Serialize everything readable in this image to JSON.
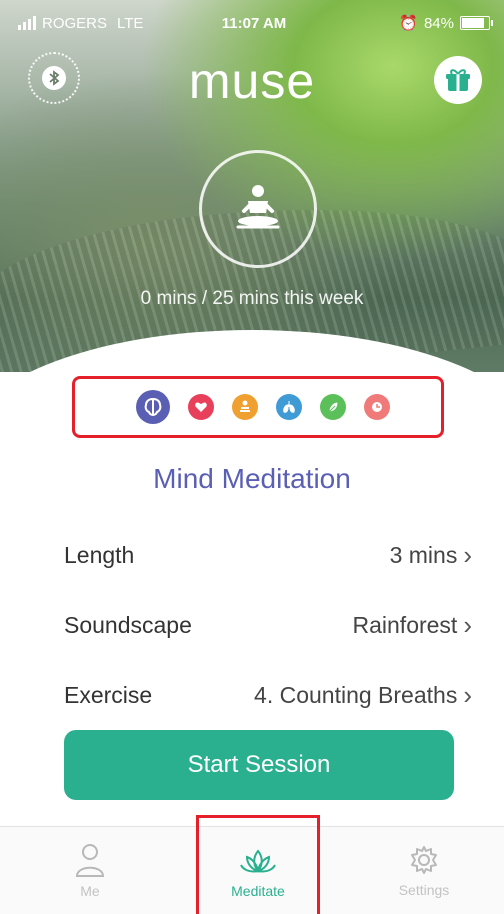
{
  "status_bar": {
    "carrier": "ROGERS",
    "network": "LTE",
    "time": "11:07 AM",
    "battery": "84%",
    "battery_level": 0.84
  },
  "header": {
    "logo": "muse",
    "left_icon": "bluetooth-icon",
    "right_icon": "gift-icon"
  },
  "hero": {
    "center_icon": "meditation-pose-icon",
    "week_progress": "0 mins / 25 mins this week"
  },
  "meditation_types": [
    {
      "icon": "brain-icon",
      "color": "#5a5fb4",
      "active": true
    },
    {
      "icon": "heart-icon",
      "color": "#e8405a",
      "active": false
    },
    {
      "icon": "body-icon",
      "color": "#f0a030",
      "active": false
    },
    {
      "icon": "lungs-icon",
      "color": "#3f9ad6",
      "active": false
    },
    {
      "icon": "leaf-icon",
      "color": "#5cc05a",
      "active": false
    },
    {
      "icon": "timer-icon",
      "color": "#f07a7a",
      "active": false
    }
  ],
  "selection": {
    "title": "Mind Meditation",
    "length": {
      "label": "Length",
      "value": "3 mins"
    },
    "soundscape": {
      "label": "Soundscape",
      "value": "Rainforest"
    },
    "exercise": {
      "label": "Exercise",
      "value": "4. Counting Breaths"
    }
  },
  "start_button": "Start Session",
  "tabs": [
    {
      "label": "Me",
      "icon": "person-icon",
      "active": false
    },
    {
      "label": "Meditate",
      "icon": "lotus-icon",
      "active": true
    },
    {
      "label": "Settings",
      "icon": "gear-icon",
      "active": false
    }
  ],
  "colors": {
    "accent": "#2ab08f",
    "title": "#5a5fb4",
    "highlight_border": "#e5202b"
  }
}
